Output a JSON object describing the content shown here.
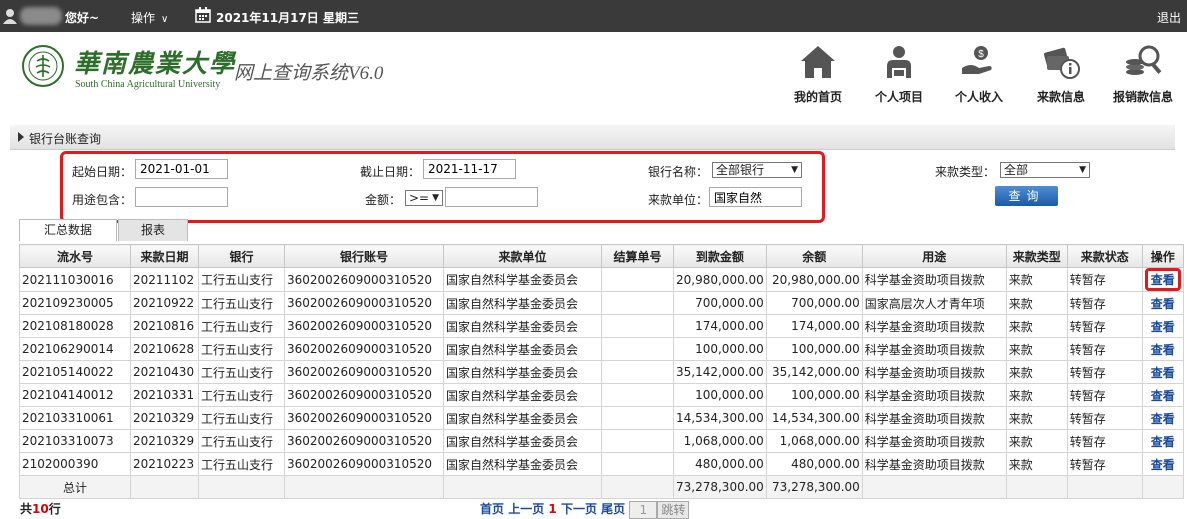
{
  "topbar": {
    "greeting": "您好~",
    "ops_label": "操作",
    "date": "2021年11月17日 星期三",
    "logout": "退出"
  },
  "header": {
    "logo_cn": "華南農業大學",
    "logo_en": "South China Agricultural University",
    "system_title": "网上查询系统V6.0",
    "nav": [
      {
        "label": "我的首页",
        "icon": "home-icon"
      },
      {
        "label": "个人项目",
        "icon": "person-project-icon"
      },
      {
        "label": "个人收入",
        "icon": "income-icon"
      },
      {
        "label": "来款信息",
        "icon": "payment-info-icon"
      },
      {
        "label": "报销款信息",
        "icon": "reimburse-search-icon"
      }
    ]
  },
  "section": {
    "title": "银行台账查询"
  },
  "filters": {
    "start_date_label": "起始日期：",
    "start_date": "2021-01-01",
    "end_date_label": "截止日期：",
    "end_date": "2021-11-17",
    "bank_label": "银行名称：",
    "bank_value": "全部银行",
    "payment_type_label": "来款类型：",
    "payment_type_value": "全部",
    "usage_label": "用途包含：",
    "usage_value": "",
    "amount_label": "金额：",
    "amount_op": ">=",
    "amount_value": "",
    "payer_label": "来款单位：",
    "payer_value": "国家自然",
    "query_button": "查询"
  },
  "tabs": [
    "汇总数据",
    "报表"
  ],
  "table": {
    "headers": [
      "流水号",
      "来款日期",
      "银行",
      "银行账号",
      "来款单位",
      "结算单号",
      "到款金额",
      "余额",
      "用途",
      "来款类型",
      "来款状态",
      "操作"
    ],
    "rows": [
      [
        "202111030016",
        "20211102",
        "工行五山支行",
        "3602002609000310520",
        "国家自然科学基金委员会",
        "",
        "20,980,000.00",
        "20,980,000.00",
        "科学基金资助项目拨款",
        "来款",
        "转暂存",
        "查看"
      ],
      [
        "202109230005",
        "20210922",
        "工行五山支行",
        "3602002609000310520",
        "国家自然科学基金委员会",
        "",
        "700,000.00",
        "700,000.00",
        "国家高层次人才青年项",
        "来款",
        "转暂存",
        "查看"
      ],
      [
        "202108180028",
        "20210816",
        "工行五山支行",
        "3602002609000310520",
        "国家自然科学基金委员会",
        "",
        "174,000.00",
        "174,000.00",
        "科学基金资助项目拨款",
        "来款",
        "转暂存",
        "查看"
      ],
      [
        "202106290014",
        "20210628",
        "工行五山支行",
        "3602002609000310520",
        "国家自然科学基金委员会",
        "",
        "100,000.00",
        "100,000.00",
        "科学基金资助项目拨款",
        "来款",
        "转暂存",
        "查看"
      ],
      [
        "202105140022",
        "20210430",
        "工行五山支行",
        "3602002609000310520",
        "国家自然科学基金委员会",
        "",
        "35,142,000.00",
        "35,142,000.00",
        "科学基金资助项目拨款",
        "来款",
        "转暂存",
        "查看"
      ],
      [
        "202104140012",
        "20210331",
        "工行五山支行",
        "3602002609000310520",
        "国家自然科学基金委员会",
        "",
        "100,000.00",
        "100,000.00",
        "科学基金资助项目拨款",
        "来款",
        "转暂存",
        "查看"
      ],
      [
        "202103310061",
        "20210329",
        "工行五山支行",
        "3602002609000310520",
        "国家自然科学基金委员会",
        "",
        "14,534,300.00",
        "14,534,300.00",
        "科学基金资助项目拨款",
        "来款",
        "转暂存",
        "查看"
      ],
      [
        "202103310073",
        "20210329",
        "工行五山支行",
        "3602002609000310520",
        "国家自然科学基金委员会",
        "",
        "1,068,000.00",
        "1,068,000.00",
        "科学基金资助项目拨款",
        "来款",
        "转暂存",
        "查看"
      ],
      [
        "2102000390",
        "20210223",
        "工行五山支行",
        "3602002609000310520",
        "国家自然科学基金委员会",
        "",
        "480,000.00",
        "480,000.00",
        "科学基金资助项目拨款",
        "来款",
        "转暂存",
        "查看"
      ]
    ],
    "total_label": "总计",
    "total_amount": "73,278,300.00",
    "total_balance": "73,278,300.00"
  },
  "footer": {
    "count_prefix": "共",
    "count": "10",
    "count_suffix": "行",
    "first": "首页",
    "prev": "上一页",
    "current": "1",
    "next": "下一页",
    "last": "尾页",
    "page_input": "1",
    "jump": "跳转"
  }
}
